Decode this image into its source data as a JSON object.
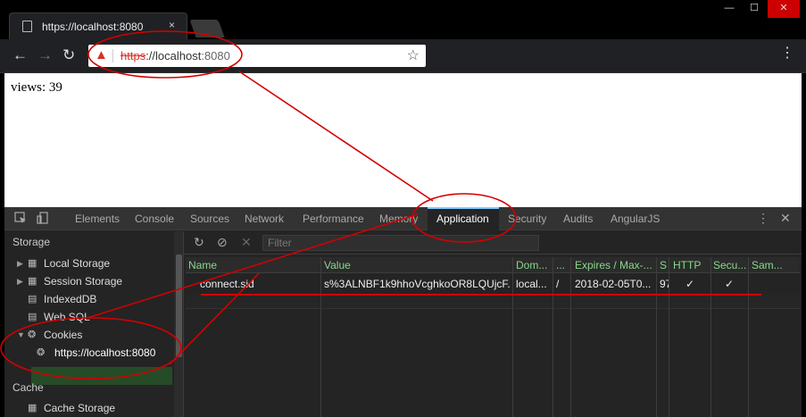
{
  "browser": {
    "tab_title": "https://localhost:8080",
    "tab_close": "×",
    "window_controls": {
      "minimize": "—",
      "maximize": "☐",
      "close": "✕"
    },
    "nav": {
      "back": "←",
      "forward": "→",
      "reload": "↻"
    },
    "address": {
      "scheme": "https",
      "rest": "://localhost",
      "port": ":8080",
      "warning_icon": "warning-triangle-icon"
    },
    "star": "☆",
    "menu": "⋮"
  },
  "page": {
    "content": "views: 39"
  },
  "devtools": {
    "tabs": [
      "Elements",
      "Console",
      "Sources",
      "Network",
      "Performance",
      "Memory",
      "Application",
      "Security",
      "Audits",
      "AngularJS"
    ],
    "active_tab": "Application",
    "more": "⋮",
    "close": "✕",
    "sidebar": {
      "storage_heading": "Storage",
      "local_storage": "Local Storage",
      "session_storage": "Session Storage",
      "indexeddb": "IndexedDB",
      "web_sql": "Web SQL",
      "cookies": "Cookies",
      "cookie_origin": "https://localhost:8080",
      "cache_heading": "Cache",
      "cache_storage": "Cache Storage"
    },
    "filter": {
      "placeholder": "Filter",
      "refresh": "↻",
      "clear": "⊘",
      "delete": "✕"
    },
    "table": {
      "columns": [
        "Name",
        "Value",
        "Dom...",
        "...",
        "Expires / Max-...",
        "S",
        "HTTP",
        "Secu...",
        "Sam..."
      ],
      "rows": [
        [
          "connect.sid",
          "s%3ALNBF1k9hhoVcghkoOR8LQUjcF...",
          "local...",
          "/",
          "2018-02-05T0...",
          "97",
          "✓",
          "✓",
          ""
        ]
      ]
    }
  },
  "colors": {
    "accent_green": "#88d88c",
    "annotation_red": "#d40000",
    "selected_bg": "#264b27"
  }
}
